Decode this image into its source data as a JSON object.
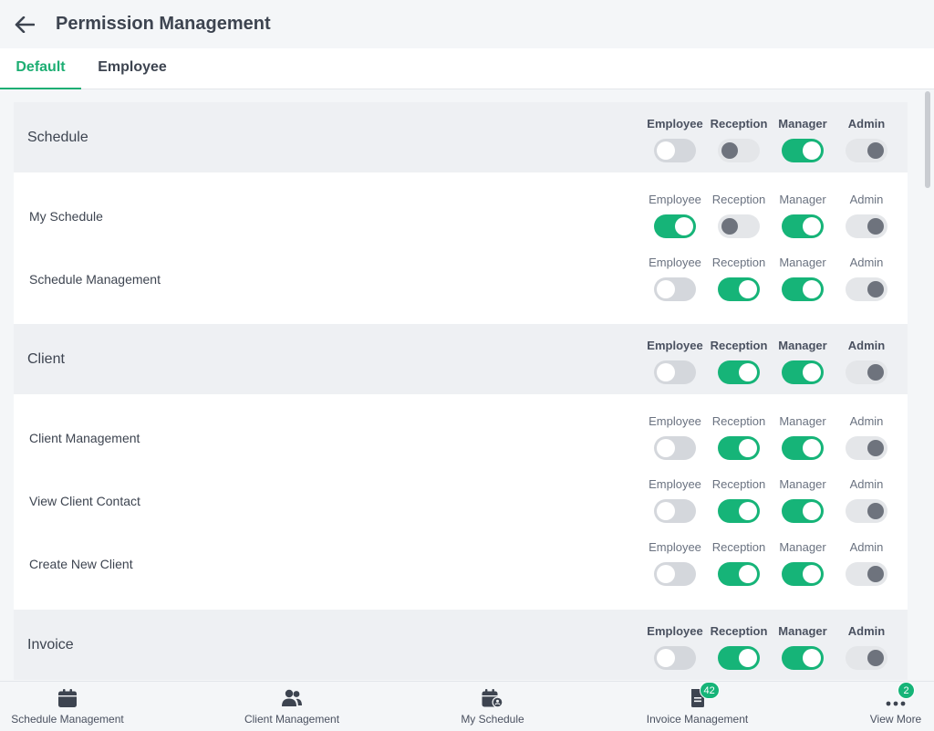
{
  "header": {
    "title": "Permission Management",
    "back_icon": "arrow-left-icon"
  },
  "tabs": [
    {
      "label": "Default",
      "active": true
    },
    {
      "label": "Employee",
      "active": false
    }
  ],
  "roles": [
    "Employee",
    "Reception",
    "Manager",
    "Admin"
  ],
  "sections": [
    {
      "title": "Schedule",
      "toggles": [
        "off",
        "disabled-off",
        "on",
        "disabled-on"
      ],
      "items": [
        {
          "label": "My Schedule",
          "toggles": [
            "on",
            "disabled-off",
            "on",
            "disabled-on"
          ]
        },
        {
          "label": "Schedule Management",
          "toggles": [
            "off",
            "on",
            "on",
            "disabled-on"
          ]
        }
      ]
    },
    {
      "title": "Client",
      "toggles": [
        "off",
        "on",
        "on",
        "disabled-on"
      ],
      "items": [
        {
          "label": "Client Management",
          "toggles": [
            "off",
            "on",
            "on",
            "disabled-on"
          ]
        },
        {
          "label": "View Client Contact",
          "toggles": [
            "off",
            "on",
            "on",
            "disabled-on"
          ]
        },
        {
          "label": "Create New Client",
          "toggles": [
            "off",
            "on",
            "on",
            "disabled-on"
          ]
        }
      ]
    },
    {
      "title": "Invoice",
      "toggles": [
        "off",
        "on",
        "on",
        "disabled-on"
      ],
      "items": []
    }
  ],
  "bottom_nav": [
    {
      "label": "Schedule Management",
      "icon": "calendar-icon",
      "badge": ""
    },
    {
      "label": "Client Management",
      "icon": "users-icon",
      "badge": ""
    },
    {
      "label": "My Schedule",
      "icon": "calendar-user-icon",
      "badge": ""
    },
    {
      "label": "Invoice Management",
      "icon": "document-icon",
      "badge": "42"
    },
    {
      "label": "View More",
      "icon": "more-dots-icon",
      "badge": "2"
    }
  ],
  "colors": {
    "accent": "#16b478",
    "toggle_off": "#d4d7dc",
    "toggle_disabled": "#e4e6e9",
    "text": "#3d4450"
  }
}
